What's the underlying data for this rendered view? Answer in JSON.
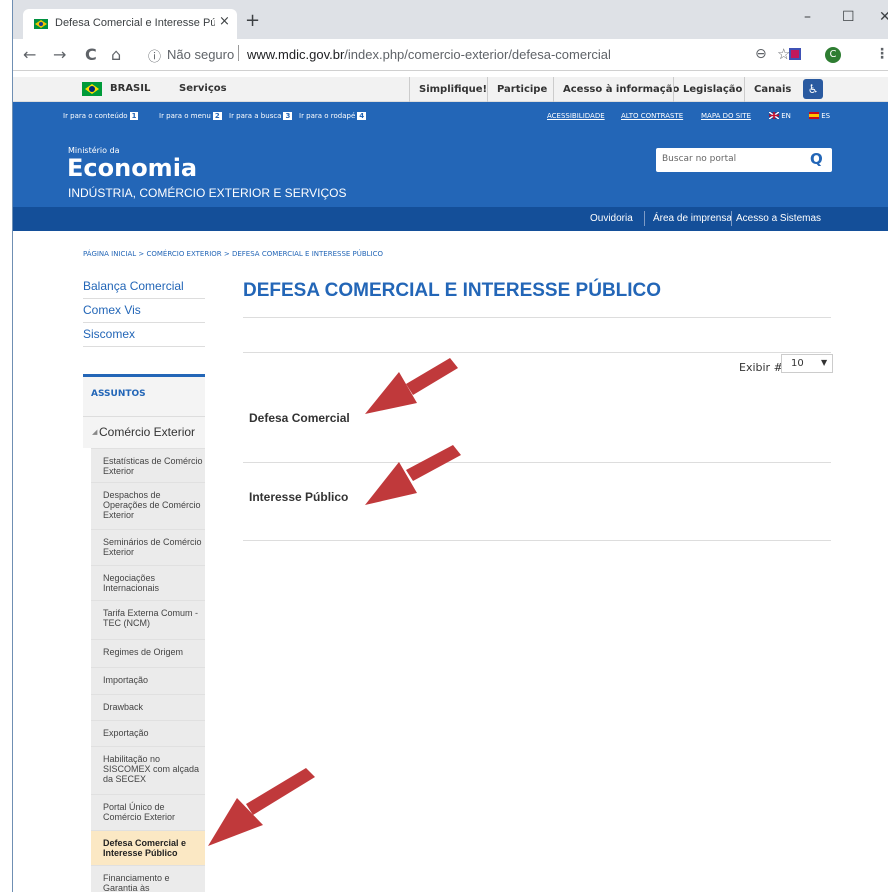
{
  "browser": {
    "tab_title": "Defesa Comercial e Interesse Púb",
    "tab_close": "×",
    "new_tab": "+",
    "minimize": "–",
    "maximize": "☐",
    "close": "✕",
    "back": "←",
    "forward": "→",
    "reload": "C",
    "home": "⌂",
    "info": "ⓘ",
    "security": "Não seguro",
    "url_domain": "www.mdic.gov.br",
    "url_path": "/index.php/comercio-exterior/defesa-comercial",
    "zoom": "⊖",
    "star": "☆",
    "profile": "C",
    "menu": "⋮"
  },
  "govbar": {
    "brasil": "BRASIL",
    "servicos": "Serviços",
    "menu": [
      "Simplifique!",
      "Participe",
      "Acesso à informação",
      "Legislação",
      "Canais"
    ],
    "a11y_icon": "♿"
  },
  "header": {
    "skip_links": [
      {
        "label": "Ir para o conteúdo",
        "num": "1"
      },
      {
        "label": "Ir para o menu",
        "num": "2"
      },
      {
        "label": "Ir para a busca",
        "num": "3"
      },
      {
        "label": "Ir para o rodapé",
        "num": "4"
      }
    ],
    "top_links": [
      "ACESSIBILIDADE",
      "ALTO CONTRASTE",
      "MAPA DO SITE"
    ],
    "lang_en": "EN",
    "lang_es": "ES",
    "ministerio": "Ministério da",
    "economia": "Economia",
    "subtitle": "INDÚSTRIA, COMÉRCIO EXTERIOR E SERVIÇOS",
    "search_placeholder": "Buscar no portal",
    "search_icon": "Q"
  },
  "services": [
    "Ouvidoria",
    "Área de imprensa",
    "Acesso a Sistemas"
  ],
  "breadcrumb": "PÁGINA INICIAL > COMÉRCIO EXTERIOR > DEFESA COMERCIAL E INTERESSE PÚBLICO",
  "sidebar": {
    "top_links": [
      "Balança Comercial",
      "Comex Vis",
      "Siscomex"
    ],
    "assuntos": "ASSUNTOS",
    "section": "Comércio Exterior",
    "section_icon": "◢",
    "items": [
      "Estatísticas de Comércio Exterior",
      "Despachos de Operações de Comércio Exterior",
      "Seminários de Comércio Exterior",
      "Negociações Internacionais",
      "Tarifa Externa Comum - TEC (NCM)",
      "Regimes de Origem",
      "Importação",
      "Drawback",
      "Exportação",
      "Habilitação no SISCOMEX com alçada da SECEX",
      "Portal Único de Comércio Exterior",
      "Defesa Comercial e Interesse Público",
      "Financiamento e Garantia às"
    ]
  },
  "main": {
    "title": "DEFESA COMERCIAL E INTERESSE PÚBLICO",
    "exibir": "Exibir #",
    "exibir_value": "10",
    "select_caret": "▼",
    "results": [
      "Defesa Comercial",
      "Interesse Público"
    ]
  },
  "colors": {
    "header_blue": "#2366b7",
    "bar_blue": "#144f99",
    "arrow_red": "#c0393b",
    "active_item": "#fbe8c4"
  }
}
